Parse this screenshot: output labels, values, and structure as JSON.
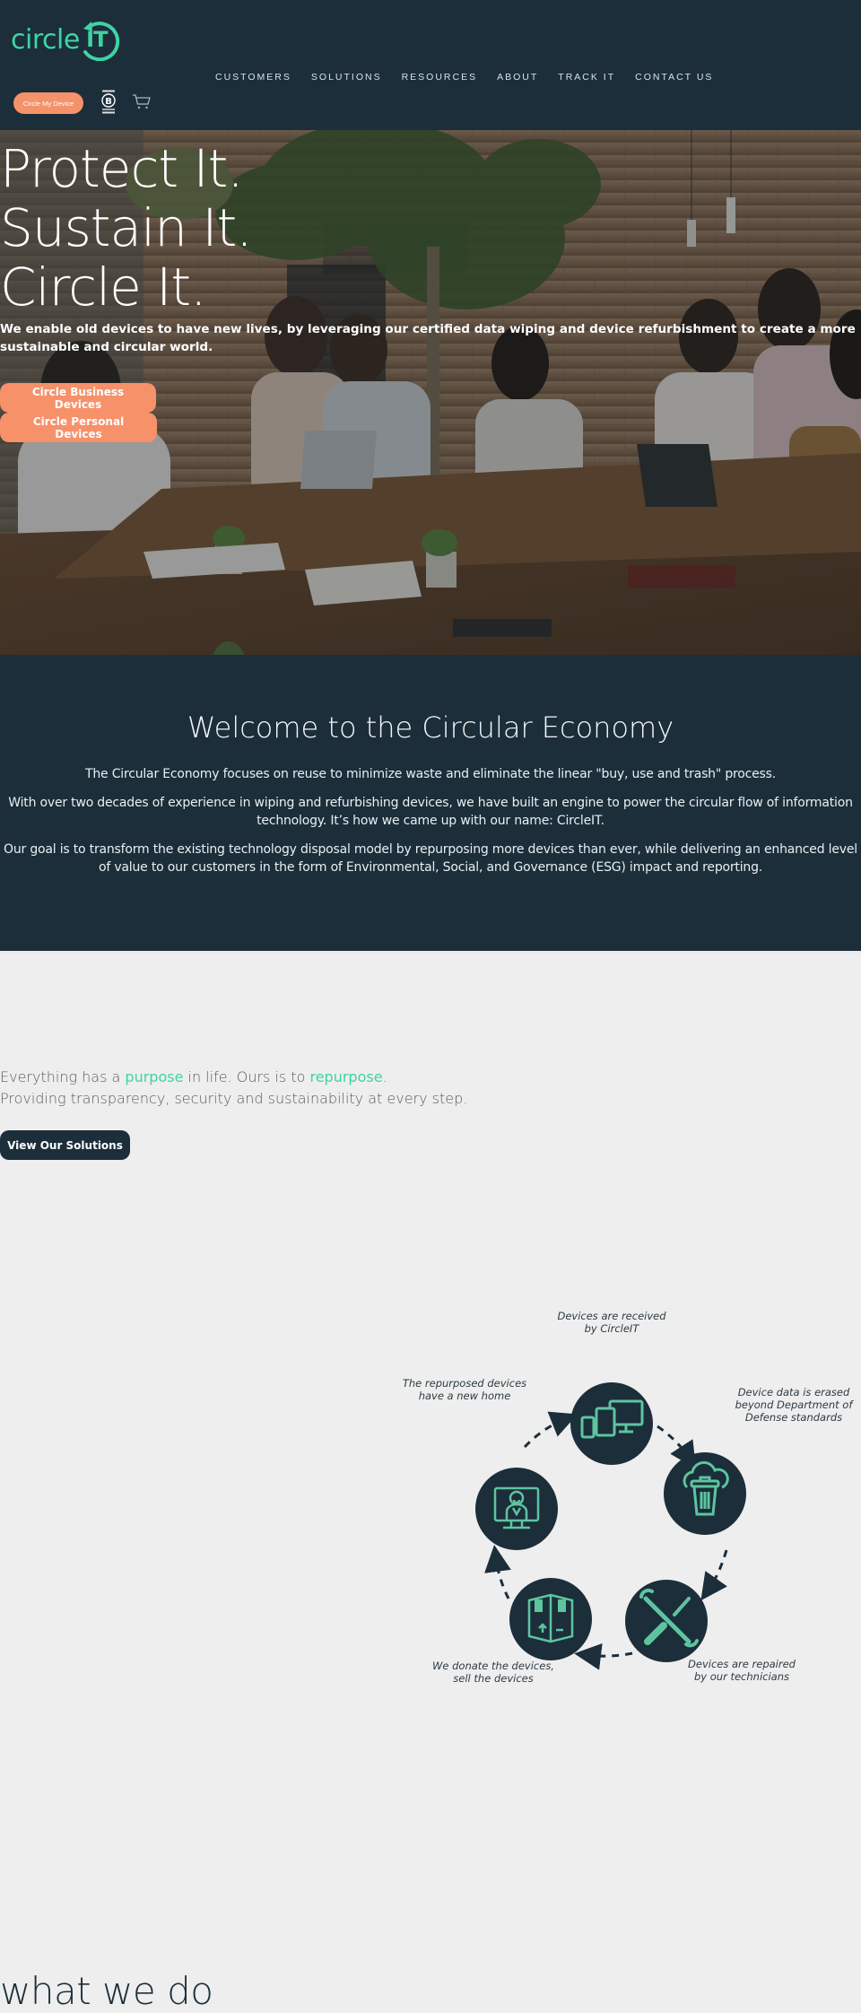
{
  "header": {
    "logo": {
      "text": "circle",
      "suffix": "IT"
    },
    "nav": [
      {
        "label": "CUSTOMERS"
      },
      {
        "label": "SOLUTIONS"
      },
      {
        "label": "RESOURCES"
      },
      {
        "label": "ABOUT"
      },
      {
        "label": "TRACK IT"
      },
      {
        "label": "CONTACT US"
      }
    ],
    "cta_label": "Circle My Device",
    "bcorp_icon": "certified-b-corporation-icon",
    "cart_icon": "shopping-cart-icon"
  },
  "hero": {
    "title_lines": [
      "Protect It.",
      "Sustain It.",
      "Circle It."
    ],
    "subtitle": "We enable old devices to have new lives, by leveraging our certified data wiping and device refurbishment to create a more sustainable and circular world.",
    "buttons": [
      {
        "label": "Circle Business Devices"
      },
      {
        "label": "Circle Personal Devices"
      }
    ]
  },
  "welcome": {
    "title": "Welcome to the Circular Economy",
    "paragraphs": [
      "The Circular Economy focuses on reuse to minimize waste and eliminate the linear \"buy, use and trash\" process.",
      "With over two decades of experience in wiping and refurbishing devices, we have built an engine to power the circular flow of information technology. It’s how we came up with our name: CircleIT.",
      "Our goal is to transform the existing technology disposal model by repurposing more devices than ever, while delivering an enhanced level of value to our customers in the form of Environmental, Social, and Governance (ESG) impact and reporting."
    ]
  },
  "what_we_do": {
    "title": "what we do",
    "line1": {
      "part1": "Everything has a ",
      "accent1": "purpose",
      "part2": " in life. Ours is to ",
      "accent2": "repurpose",
      "part3": "."
    },
    "line2": "Providing transparency, security and sustainability at every step.",
    "button_label": "View Our Solutions"
  },
  "cycle": {
    "steps": [
      {
        "label_lines": [
          "Devices are received",
          "by CircleIT"
        ],
        "icon": "devices-icon"
      },
      {
        "label_lines": [
          "Device data is erased",
          "beyond Department of",
          "Defense standards"
        ],
        "icon": "cloud-trash-icon"
      },
      {
        "label_lines": [
          "Devices are repaired",
          "by our technicians"
        ],
        "icon": "wrench-screwdriver-icon"
      },
      {
        "label_lines": [
          "We donate the devices,",
          "sell the devices"
        ],
        "icon": "box-icon"
      },
      {
        "label_lines": [
          "The repurposed devices",
          "have a new home"
        ],
        "icon": "person-monitor-icon"
      }
    ]
  },
  "colors": {
    "navy": "#1b2e3a",
    "teal": "#3fd3a4",
    "orange": "#f6916a",
    "light_bg": "#eeeeee",
    "icon_teal": "#5ec4a0"
  }
}
